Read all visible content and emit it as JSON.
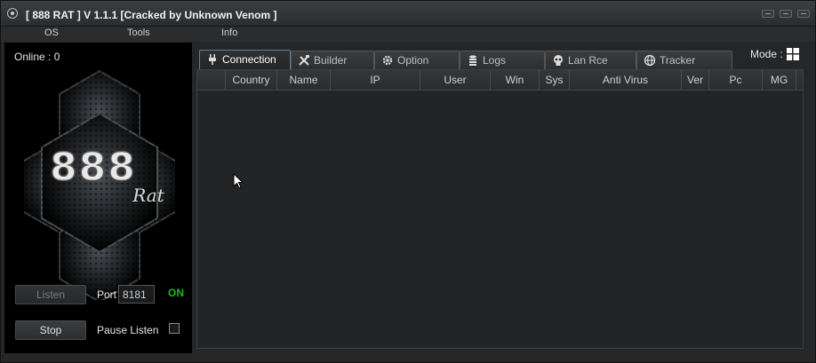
{
  "window": {
    "title": "[  888 RAT  ] V 1.1.1 [Cracked by Unknown Venom ]"
  },
  "menu": [
    "OS",
    "Tools",
    "Info"
  ],
  "left_panel": {
    "online_text": "Online : 0",
    "logo_number": "888",
    "logo_word": "Rat",
    "listen_label": "Listen",
    "port_label": "Port",
    "port_value": "8181",
    "status": "ON",
    "stop_label": "Stop",
    "pause_label": "Pause Listen",
    "pause_checked": false
  },
  "mode_label": "Mode :",
  "tabs": [
    {
      "label": "Connection",
      "icon": "plug-icon",
      "active": true
    },
    {
      "label": "Builder",
      "icon": "tools-icon",
      "active": false
    },
    {
      "label": "Option",
      "icon": "gear-icon",
      "active": false
    },
    {
      "label": "Logs",
      "icon": "database-icon",
      "active": false
    },
    {
      "label": "Lan Rce",
      "icon": "skull-icon",
      "active": false
    },
    {
      "label": "Tracker",
      "icon": "globe-icon",
      "active": false
    }
  ],
  "columns": [
    "",
    "Country",
    "Name",
    "IP",
    "User",
    "Win",
    "Sys",
    "Anti Virus",
    "Ver",
    "Pc",
    "MG"
  ],
  "rows": [],
  "colors": {
    "accent": "#5a7fa8",
    "status_on": "#1fb81f"
  }
}
